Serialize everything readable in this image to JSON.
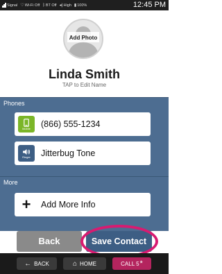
{
  "status_bar": {
    "signal_label": "Signal",
    "wifi_label": "Wi-Fi Off",
    "bt_label": "BT Off",
    "volume_label": "High",
    "battery_label": "100%",
    "clock": "12:45 PM"
  },
  "profile": {
    "add_photo_label": "Add Photo",
    "name": "Linda Smith",
    "edit_hint": "TAP to Edit Name"
  },
  "sections": {
    "phones_header": "Phones",
    "more_header": "More"
  },
  "rows": {
    "phone_number": "(866) 555-1234",
    "phone_badge_sub": "Mobile",
    "phone_badge_color": "#7bb628",
    "ringtone": "Jitterbug Tone",
    "ringtone_badge_sub": "Ringer",
    "ringtone_badge_color": "#3d5e84",
    "add_more": "Add More Info"
  },
  "buttons": {
    "back": "Back",
    "save": "Save Contact"
  },
  "nav": {
    "back": "BACK",
    "home": "HOME",
    "call": "CALL 5"
  },
  "colors": {
    "panel": "#4d6d91",
    "highlight": "#d81b71",
    "call_button": "#b4245e"
  }
}
